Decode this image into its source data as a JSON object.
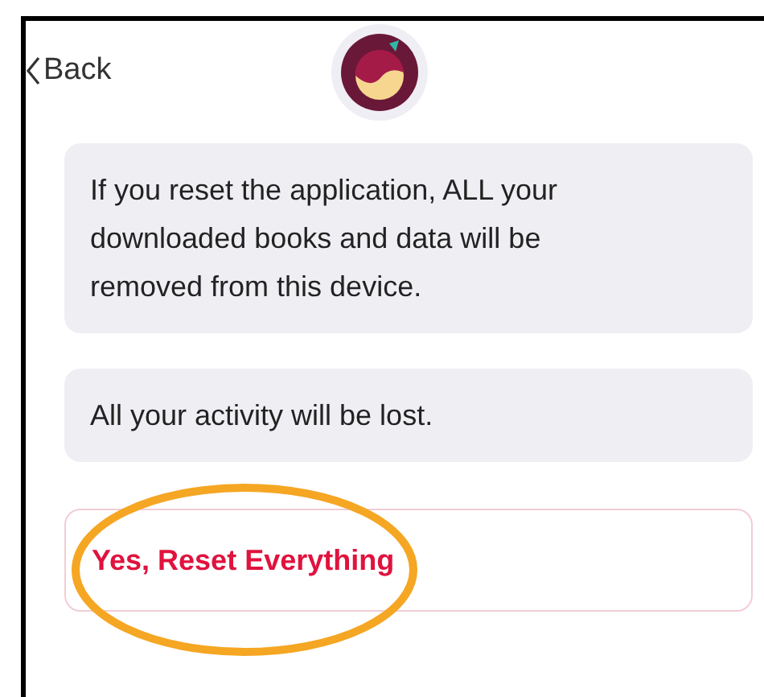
{
  "header": {
    "back": "Back"
  },
  "messages": [
    "If you reset the application, ALL your downloaded books and data will be removed from this device.",
    "All your activity will be lost."
  ],
  "reset_button": {
    "label": "Yes, Reset Everything"
  }
}
